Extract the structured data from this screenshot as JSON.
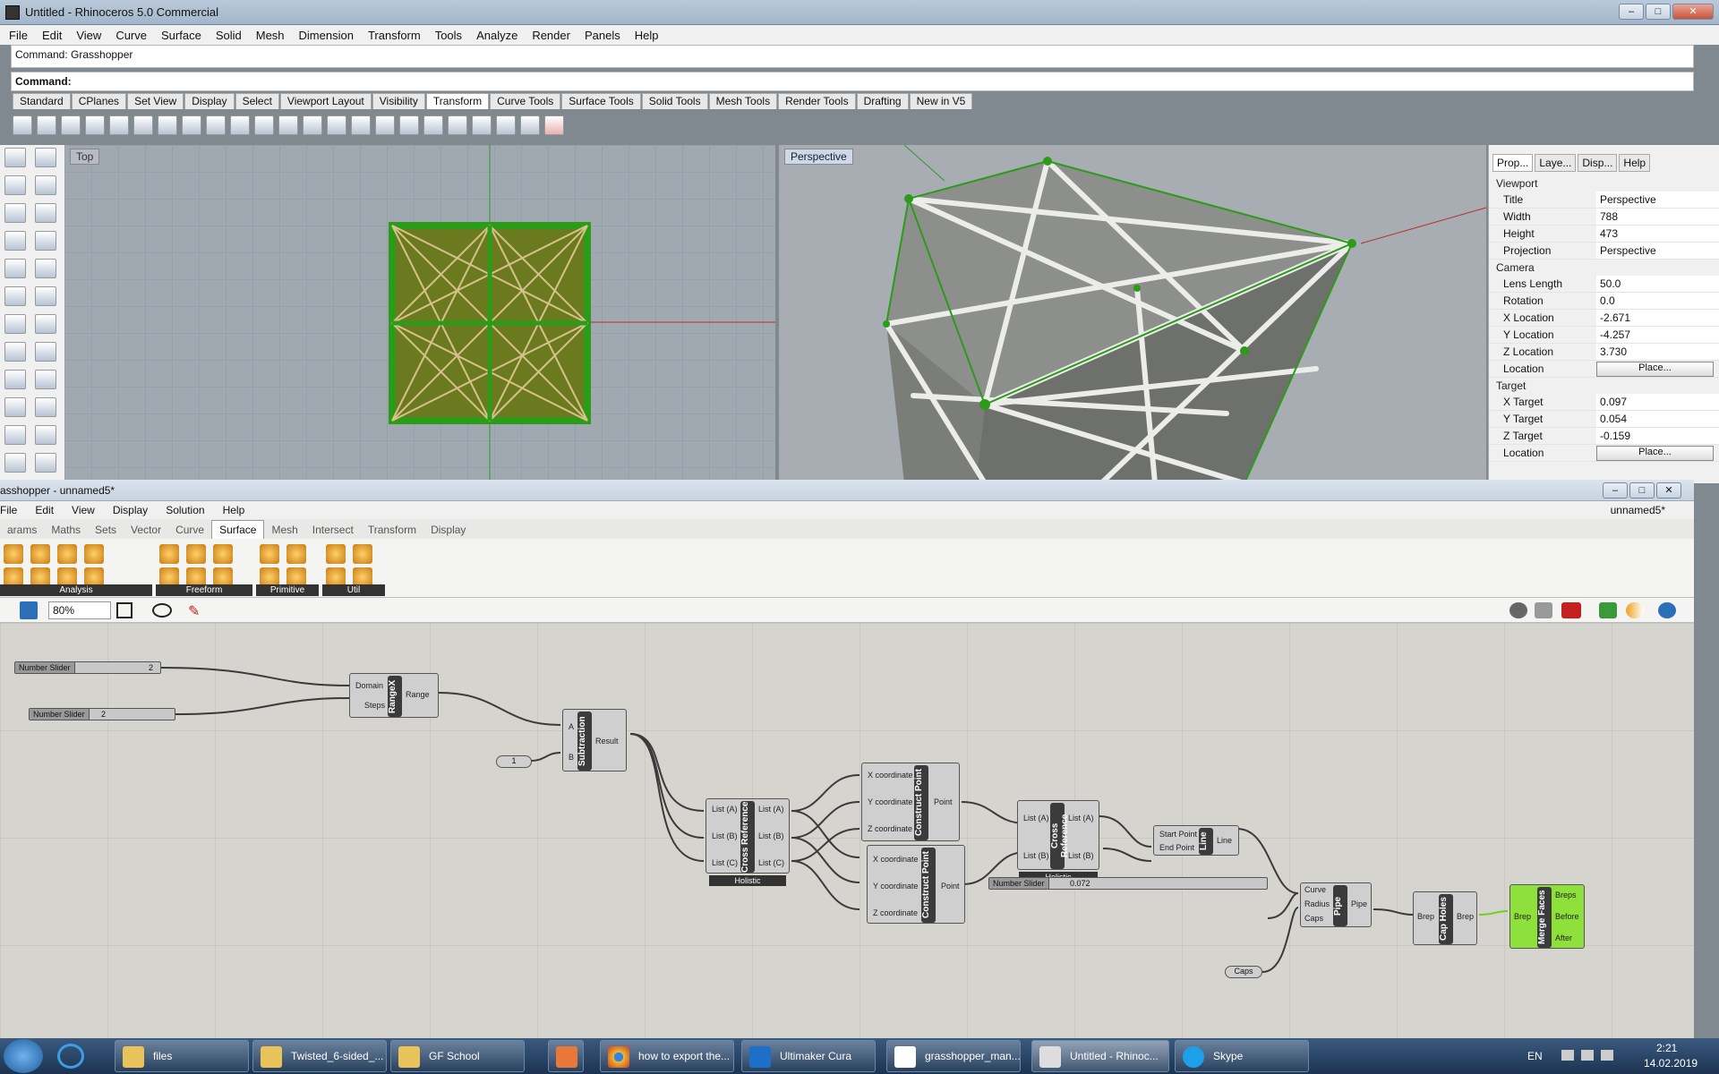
{
  "window": {
    "title": "Untitled - Rhinoceros 5.0 Commercial"
  },
  "menu": [
    "File",
    "Edit",
    "View",
    "Curve",
    "Surface",
    "Solid",
    "Mesh",
    "Dimension",
    "Transform",
    "Tools",
    "Analyze",
    "Render",
    "Panels",
    "Help"
  ],
  "command": {
    "history": "Command: Grasshopper",
    "prompt": "Command:"
  },
  "tabs": [
    "Standard",
    "CPlanes",
    "Set View",
    "Display",
    "Select",
    "Viewport Layout",
    "Visibility",
    "Transform",
    "Curve Tools",
    "Surface Tools",
    "Solid Tools",
    "Mesh Tools",
    "Render Tools",
    "Drafting",
    "New in V5"
  ],
  "active_tab": "Transform",
  "viewports": {
    "top": "Top",
    "perspective": "Perspective"
  },
  "props": {
    "tabs": [
      "Prop...",
      "Laye...",
      "Disp...",
      "Help"
    ],
    "viewport_label": "Viewport",
    "viewport": [
      [
        "Title",
        "Perspective"
      ],
      [
        "Width",
        "788"
      ],
      [
        "Height",
        "473"
      ],
      [
        "Projection",
        "Perspective"
      ]
    ],
    "camera_label": "Camera",
    "camera": [
      [
        "Lens Length",
        "50.0"
      ],
      [
        "Rotation",
        "0.0"
      ],
      [
        "X Location",
        "-2.671"
      ],
      [
        "Y Location",
        "-4.257"
      ],
      [
        "Z Location",
        "3.730"
      ],
      [
        "Location",
        "Place..."
      ]
    ],
    "target_label": "Target",
    "target": [
      [
        "X Target",
        "0.097"
      ],
      [
        "Y Target",
        "0.054"
      ],
      [
        "Z Target",
        "-0.159"
      ],
      [
        "Location",
        "Place..."
      ]
    ]
  },
  "gh": {
    "title": "asshopper - unnamed5*",
    "doc": "unnamed5*",
    "menu": [
      "File",
      "Edit",
      "View",
      "Display",
      "Solution",
      "Help"
    ],
    "tabs": [
      "arams",
      "Maths",
      "Sets",
      "Vector",
      "Curve",
      "Surface",
      "Mesh",
      "Intersect",
      "Transform",
      "Display"
    ],
    "active_tab": "Surface",
    "groups": [
      "Analysis",
      "Freeform",
      "Primitive",
      "Util"
    ],
    "zoom": "80%",
    "components": {
      "slider1": {
        "label": "Number Slider",
        "value": "2"
      },
      "slider2": {
        "label": "Number Slider",
        "value": "2"
      },
      "slider3": {
        "label": "Number Slider",
        "value": "0.072"
      },
      "one": "1",
      "caps": "Caps",
      "range": {
        "name": "RangeX",
        "in": [
          "Domain",
          "Steps"
        ],
        "out": "Range"
      },
      "sub": {
        "name": "Subtraction",
        "in": [
          "A",
          "B"
        ],
        "out": "Result"
      },
      "xref1": {
        "name": "Cross Reference",
        "in": [
          "List (A)",
          "List (B)",
          "List (C)"
        ],
        "out": [
          "List (A)",
          "List (B)",
          "List (C)"
        ],
        "foot": "Holistic"
      },
      "pt1": {
        "name": "Construct Point",
        "in": [
          "X coordinate",
          "Y coordinate",
          "Z coordinate"
        ],
        "out": "Point"
      },
      "pt2": {
        "name": "Construct Point",
        "in": [
          "X coordinate",
          "Y coordinate",
          "Z coordinate"
        ],
        "out": "Point"
      },
      "xref2": {
        "name": "Cross Reference",
        "in": [
          "List (A)",
          "List (B)"
        ],
        "out": [
          "List (A)",
          "List (B)"
        ],
        "foot": "Holistic"
      },
      "line": {
        "name": "Line",
        "in": [
          "Start Point",
          "End Point"
        ],
        "out": "Line"
      },
      "pipe": {
        "name": "Pipe",
        "in": [
          "Curve",
          "Radius",
          "Caps"
        ],
        "out": "Pipe"
      },
      "cap": {
        "name": "Cap Holes",
        "in": [
          "Brep"
        ],
        "out": "Brep"
      },
      "merge": {
        "name": "Merge Faces",
        "in": [
          "Brep"
        ],
        "out": [
          "Breps",
          "Before",
          "After"
        ]
      }
    }
  },
  "taskbar": {
    "items": [
      "files",
      "Twisted_6-sided_...",
      "GF School",
      "",
      "how to export the...",
      "Ultimaker Cura",
      "grasshopper_man...",
      "Untitled - Rhinoc...",
      "Skype"
    ],
    "lang": "EN",
    "time": "2:21",
    "date": "14.02.2019"
  },
  "colors": {
    "accent_green": "#8ee03a",
    "wire": "#3a3a3a",
    "axis_red": "#c0282a"
  }
}
